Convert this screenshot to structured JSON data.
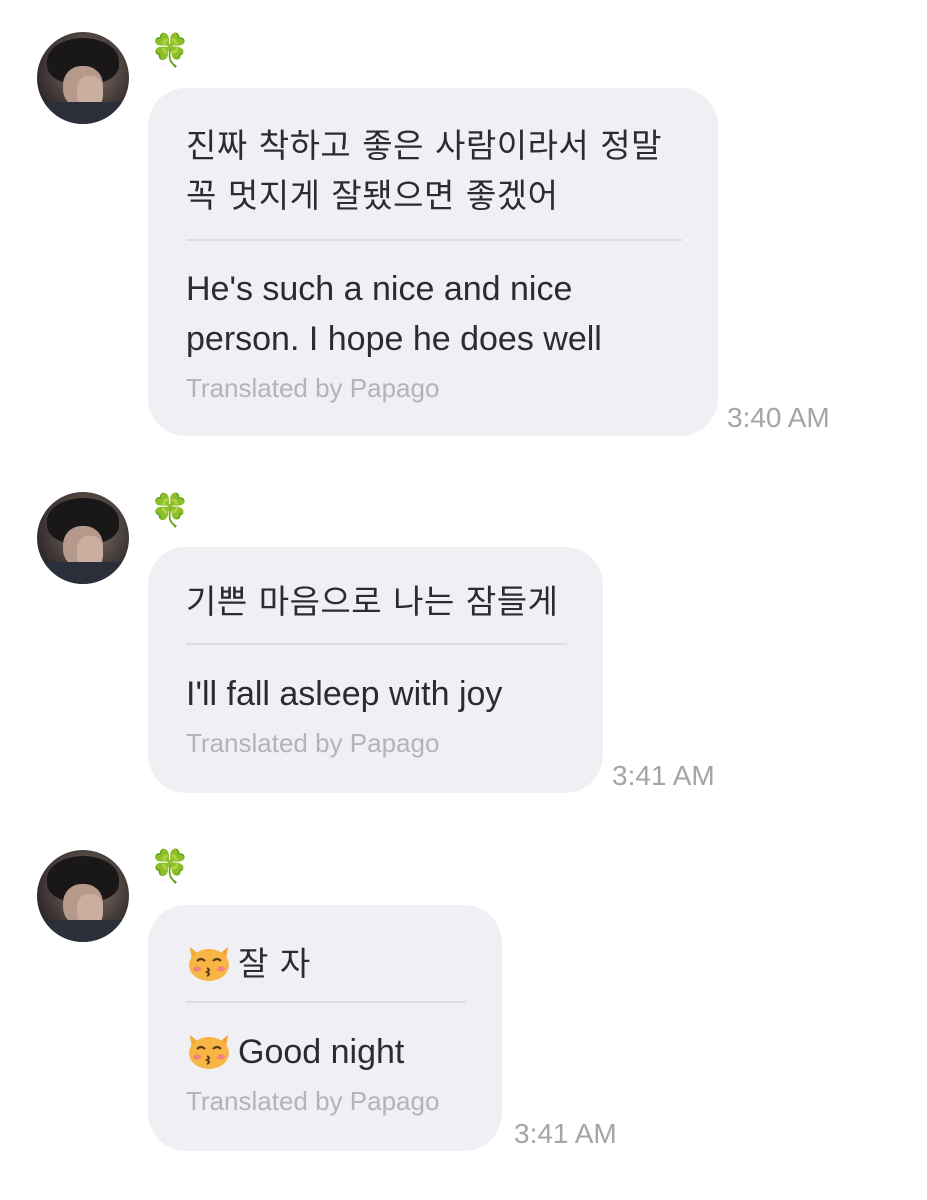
{
  "messages": [
    {
      "original": "진짜 착하고 좋은 사람이라서 정말 꼭 멋지게 잘됐으면 좋겠어",
      "translated": "He's such a nice and nice person. I hope he does well",
      "credit": "Translated by Papago",
      "time": "3:40 AM"
    },
    {
      "original": "기쁜 마음으로 나는 잠들게",
      "translated": "I'll fall asleep with joy",
      "credit": "Translated by Papago",
      "time": "3:41 AM"
    },
    {
      "original": "잘 자",
      "translated": "Good night",
      "credit": "Translated by Papago",
      "time": "3:41 AM",
      "emoji": "kissing-cat-icon"
    }
  ],
  "status_emoji": "four-leaf-clover-icon",
  "colors": {
    "bubble": "#efeff4",
    "timestamp": "#a4a4a9",
    "credit": "#b3b3b8"
  }
}
